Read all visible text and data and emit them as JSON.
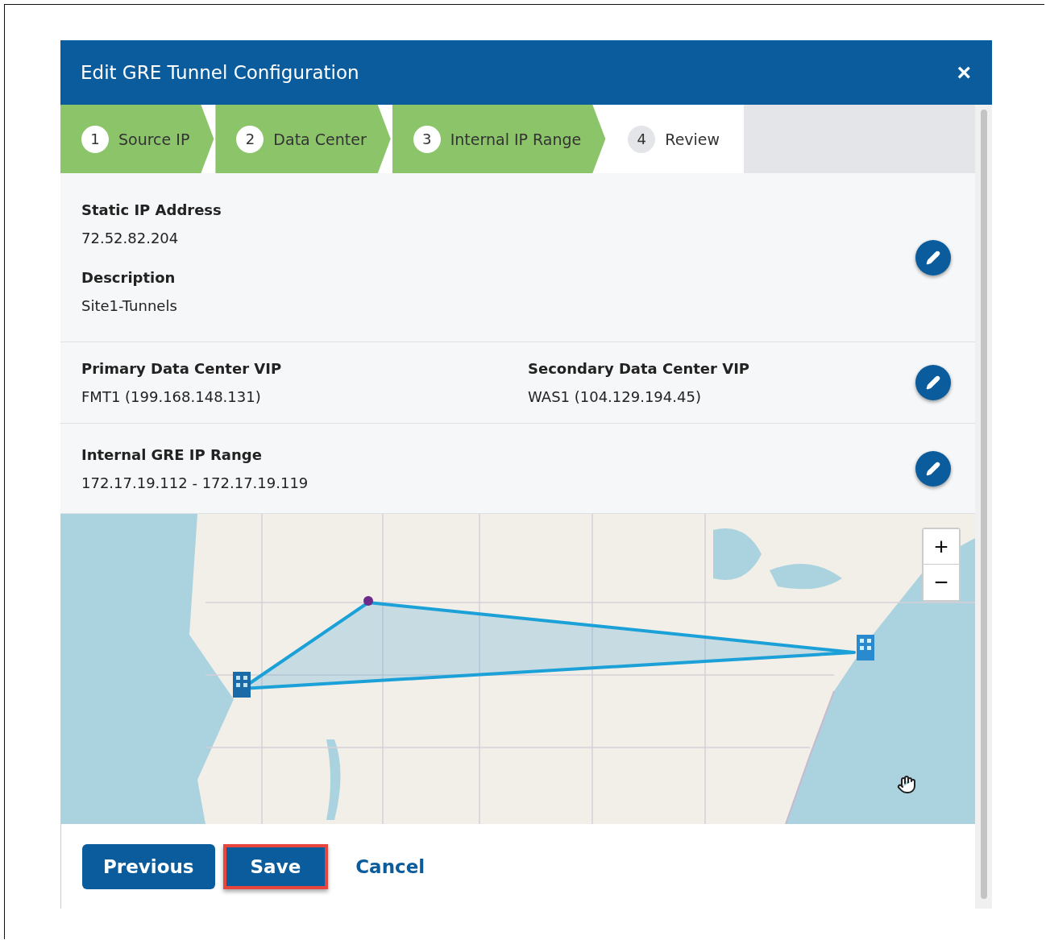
{
  "dialog": {
    "title": "Edit GRE Tunnel Configuration",
    "close": "×"
  },
  "steps": [
    {
      "number": "1",
      "label": "Source IP",
      "completed": true
    },
    {
      "number": "2",
      "label": "Data Center",
      "completed": true
    },
    {
      "number": "3",
      "label": "Internal IP Range",
      "completed": true
    },
    {
      "number": "4",
      "label": "Review",
      "completed": false
    }
  ],
  "sections": [
    {
      "fields": [
        {
          "label": "Static IP Address",
          "value": "72.52.82.204"
        },
        {
          "label": "Description",
          "value": "Site1-Tunnels"
        }
      ]
    },
    {
      "fields": [
        {
          "label": "Primary Data Center VIP",
          "value": "FMT1 (199.168.148.131)"
        },
        {
          "label": "Secondary Data Center VIP",
          "value": "WAS1 (104.129.194.45)"
        }
      ]
    },
    {
      "fields": [
        {
          "label": "Internal GRE IP Range",
          "value": "172.17.19.112 - 172.17.19.119"
        }
      ]
    }
  ],
  "map": {
    "kind": "picture",
    "zoom_in": "+",
    "zoom_out": "−"
  },
  "buttons": [
    {
      "label": "Previous",
      "kind": "primary",
      "highlighted": false
    },
    {
      "label": "Save",
      "kind": "primary",
      "highlighted": true
    },
    {
      "label": "Cancel",
      "kind": "link",
      "highlighted": false
    }
  ]
}
